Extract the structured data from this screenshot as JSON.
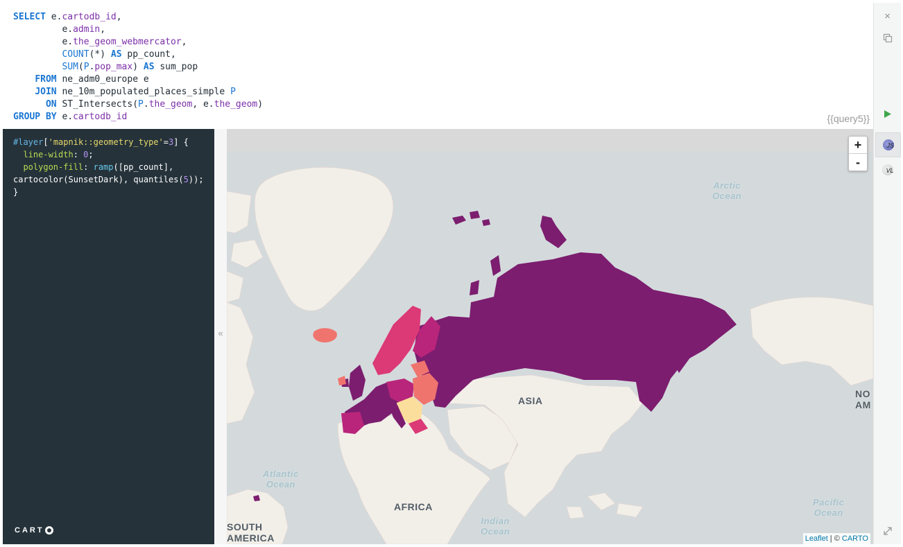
{
  "sql": {
    "lines": [
      [
        {
          "t": "SELECT",
          "c": "kw"
        },
        {
          "t": " e.",
          "c": "plain"
        },
        {
          "t": "cartodb_id",
          "c": "attr"
        },
        {
          "t": ",",
          "c": "plain"
        }
      ],
      [
        {
          "t": "         e.",
          "c": "plain"
        },
        {
          "t": "admin",
          "c": "attr"
        },
        {
          "t": ",",
          "c": "plain"
        }
      ],
      [
        {
          "t": "         e.",
          "c": "plain"
        },
        {
          "t": "the_geom_webmercator",
          "c": "attr"
        },
        {
          "t": ",",
          "c": "plain"
        }
      ],
      [
        {
          "t": "         ",
          "c": "plain"
        },
        {
          "t": "COUNT",
          "c": "fn"
        },
        {
          "t": "(*) ",
          "c": "plain"
        },
        {
          "t": "AS",
          "c": "kw"
        },
        {
          "t": " pp_count,",
          "c": "plain"
        }
      ],
      [
        {
          "t": "         ",
          "c": "plain"
        },
        {
          "t": "SUM",
          "c": "fn"
        },
        {
          "t": "(",
          "c": "plain"
        },
        {
          "t": "P",
          "c": "fn"
        },
        {
          "t": ".",
          "c": "plain"
        },
        {
          "t": "pop_max",
          "c": "attr"
        },
        {
          "t": ") ",
          "c": "plain"
        },
        {
          "t": "AS",
          "c": "kw"
        },
        {
          "t": " sum_pop",
          "c": "plain"
        }
      ],
      [
        {
          "t": "    ",
          "c": "plain"
        },
        {
          "t": "FROM",
          "c": "kw"
        },
        {
          "t": " ne_adm0_europe e",
          "c": "plain"
        }
      ],
      [
        {
          "t": "    ",
          "c": "plain"
        },
        {
          "t": "JOIN",
          "c": "kw"
        },
        {
          "t": " ne_10m_populated_places_simple ",
          "c": "plain"
        },
        {
          "t": "P",
          "c": "fn"
        }
      ],
      [
        {
          "t": "      ",
          "c": "plain"
        },
        {
          "t": "ON",
          "c": "kw"
        },
        {
          "t": " ST_Intersects(",
          "c": "plain"
        },
        {
          "t": "P",
          "c": "fn"
        },
        {
          "t": ".",
          "c": "plain"
        },
        {
          "t": "the_geom",
          "c": "attr"
        },
        {
          "t": ", e.",
          "c": "plain"
        },
        {
          "t": "the_geom",
          "c": "attr"
        },
        {
          "t": ")",
          "c": "plain"
        }
      ],
      [
        {
          "t": "GROUP BY",
          "c": "kw"
        },
        {
          "t": " e.",
          "c": "plain"
        },
        {
          "t": "cartodb_id",
          "c": "attr"
        }
      ]
    ],
    "query_tag": "{{query5}}"
  },
  "cartocss": {
    "lines": [
      [
        {
          "t": "#layer",
          "c": "c-sel"
        },
        {
          "t": "[",
          "c": "c-val"
        },
        {
          "t": "'mapnik::geometry_type'",
          "c": "c-str"
        },
        {
          "t": "=",
          "c": "c-val"
        },
        {
          "t": "3",
          "c": "c-num"
        },
        {
          "t": "] {",
          "c": "c-val"
        }
      ],
      [
        {
          "t": "  ",
          "c": "c-val"
        },
        {
          "t": "line-width",
          "c": "c-prop"
        },
        {
          "t": ": ",
          "c": "c-val"
        },
        {
          "t": "0",
          "c": "c-num"
        },
        {
          "t": ";",
          "c": "c-val"
        }
      ],
      [
        {
          "t": "  ",
          "c": "c-val"
        },
        {
          "t": "polygon-fill",
          "c": "c-prop"
        },
        {
          "t": ": ",
          "c": "c-val"
        },
        {
          "t": "ramp",
          "c": "c-fn"
        },
        {
          "t": "([pp_count],",
          "c": "c-val"
        }
      ],
      [
        {
          "t": "cartocolor(SunsetDark), quantiles(",
          "c": "c-val"
        },
        {
          "t": "5",
          "c": "c-num"
        },
        {
          "t": "));",
          "c": "c-val"
        }
      ],
      [
        {
          "t": "}",
          "c": "c-val"
        }
      ]
    ],
    "logo_text": "CART"
  },
  "toolbar": {
    "close_icon": "×",
    "js_label": "JS",
    "vl_label": "VL",
    "collapse_icon": "«"
  },
  "map": {
    "zoom_in": "+",
    "zoom_out": "-",
    "labels": {
      "arctic": "Arctic\nOcean",
      "atlantic": "Atlantic\nOcean",
      "indian": "Indian\nOcean",
      "pacific": "Pacific\nOcean",
      "asia": "ASIA",
      "africa": "AFRICA",
      "south_america": "SOUTH\nAMERICA",
      "north_america": "NO\nAM"
    },
    "attribution": {
      "leaflet": "Leaflet",
      "sep": " | © ",
      "carto": "CARTO"
    },
    "colors": {
      "ocean": "#d4dadc",
      "land": "#f2efe9",
      "ramp": [
        "#fcde9c",
        "#f0746e",
        "#dc3977",
        "#b9257a",
        "#7c1d6f"
      ]
    }
  }
}
